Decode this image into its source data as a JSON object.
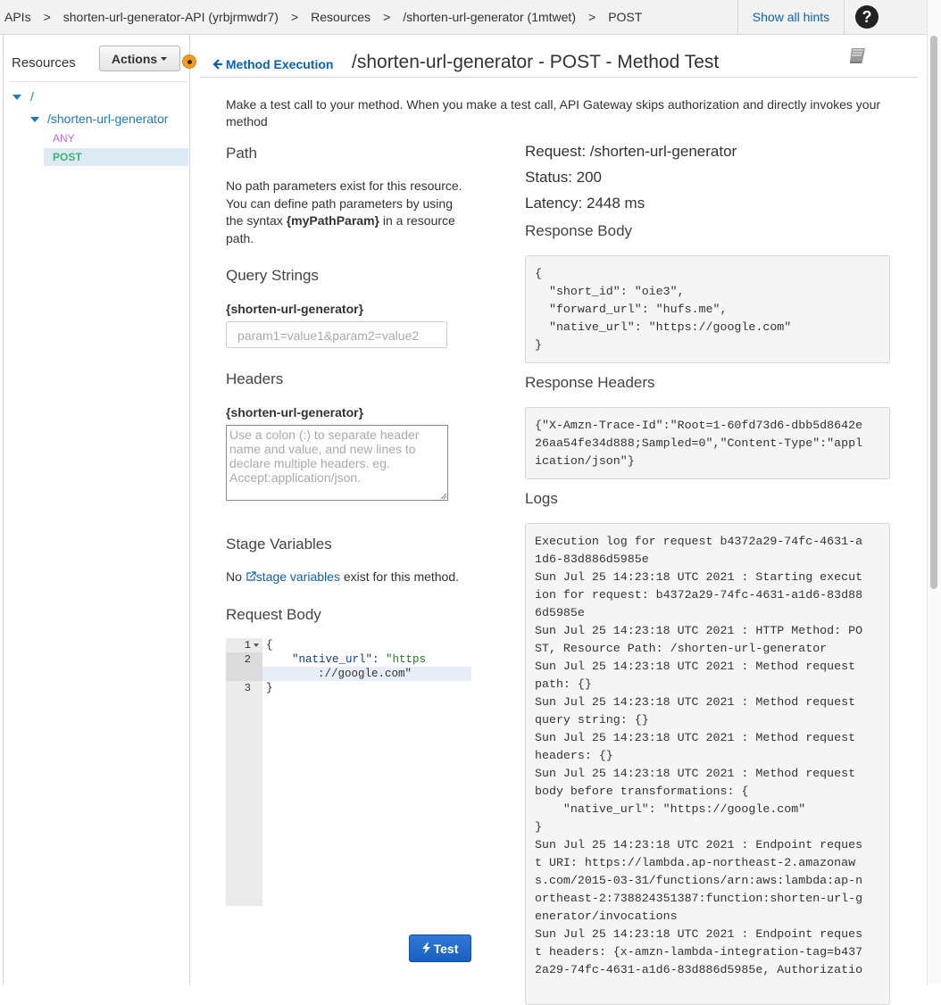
{
  "breadcrumbs": [
    "APIs",
    "shorten-url-generator-API (yrbjrmwdr7)",
    "Resources",
    "/shorten-url-generator (1mtwet)",
    "POST"
  ],
  "header": {
    "hints_label": "Show all hints",
    "help_label": "?"
  },
  "sidebar": {
    "title": "Resources",
    "actions_label": "Actions",
    "tree": {
      "root": "/",
      "resource": "/shorten-url-generator",
      "methods": [
        "ANY",
        "POST"
      ]
    }
  },
  "main": {
    "back_label": "Method Execution",
    "title": "/shorten-url-generator - POST - Method Test",
    "intro": "Make a test call to your method. When you make a test call, API Gateway skips authorization and directly invokes your method",
    "path": {
      "heading": "Path",
      "text_1": "No path parameters exist for this resource. You can define path parameters by using the syntax ",
      "text_bold": "{myPathParam}",
      "text_2": " in a resource path."
    },
    "query_strings": {
      "heading": "Query Strings",
      "label": "{shorten-url-generator}",
      "placeholder": "param1=value1&param2=value2"
    },
    "headers": {
      "heading": "Headers",
      "label": "{shorten-url-generator}",
      "placeholder": "Use a colon (:) to separate header name and value, and new lines to declare multiple headers. eg. Accept:application/json."
    },
    "stage_variables": {
      "heading": "Stage Variables",
      "text_pre": "No ",
      "link": "stage variables",
      "text_post": " exist for this method."
    },
    "request_body": {
      "heading": "Request Body",
      "line_numbers": [
        "1",
        "2",
        "3"
      ],
      "open_brace": "{",
      "key": "\"native_url\"",
      "colon": ": ",
      "value_part1": "\"https",
      "value_part2": "://google.com\"",
      "close_brace": "}"
    },
    "test_label": "Test"
  },
  "result": {
    "request": "Request: /shorten-url-generator",
    "status": "Status: 200",
    "latency": "Latency: 2448 ms",
    "response_body_heading": "Response Body",
    "response_body": "{\n  \"short_id\": \"oie3\",\n  \"forward_url\": \"hufs.me\",\n  \"native_url\": \"https://google.com\"\n}",
    "response_headers_heading": "Response Headers",
    "response_headers": "{\"X-Amzn-Trace-Id\":\"Root=1-60fd73d6-dbb5d8642e\n26aa54fe34d888;Sampled=0\",\"Content-Type\":\"appl\nication/json\"}",
    "logs_heading": "Logs",
    "logs": "Execution log for request b4372a29-74fc-4631-a\n1d6-83d886d5985e\nSun Jul 25 14:23:18 UTC 2021 : Starting execut\nion for request: b4372a29-74fc-4631-a1d6-83d88\n6d5985e\nSun Jul 25 14:23:18 UTC 2021 : HTTP Method: PO\nST, Resource Path: /shorten-url-generator\nSun Jul 25 14:23:18 UTC 2021 : Method request\npath: {}\nSun Jul 25 14:23:18 UTC 2021 : Method request\nquery string: {}\nSun Jul 25 14:23:18 UTC 2021 : Method request\nheaders: {}\nSun Jul 25 14:23:18 UTC 2021 : Method request\nbody before transformations: {\n    \"native_url\": \"https://google.com\"\n}\nSun Jul 25 14:23:18 UTC 2021 : Endpoint reques\nt URI: https://lambda.ap-northeast-2.amazonaw\ns.com/2015-03-31/functions/arn:aws:lambda:ap-n\northeast-2:738824351387:function:shorten-url-g\nenerator/invocations\nSun Jul 25 14:23:18 UTC 2021 : Endpoint reques\nt headers: {x-amzn-lambda-integration-tag=b437\n2a29-74fc-4631-a1d6-83d886d5985e, Authorizatio"
  },
  "colors": {
    "link": "#0b61b0",
    "post": "#3cb371",
    "any": "#c26bd6",
    "accent_orange": "#f59a23"
  },
  "icons": [
    "caret-left-icon",
    "book-icon",
    "external-link-icon",
    "bolt-icon",
    "caret-down-icon",
    "help-icon"
  ]
}
